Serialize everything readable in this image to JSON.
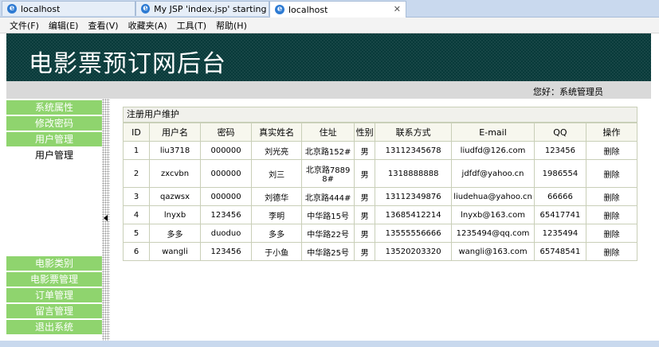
{
  "tabs": [
    {
      "label": "localhost"
    },
    {
      "label": "My JSP 'index.jsp' starting ..."
    },
    {
      "label": "localhost"
    }
  ],
  "menu": [
    "文件(F)",
    "编辑(E)",
    "查看(V)",
    "收藏夹(A)",
    "工具(T)",
    "帮助(H)"
  ],
  "site_title": "电影票预订网后台",
  "greeting": "您好：系统管理员",
  "sidebar": {
    "top": [
      "系统属性",
      "修改密码",
      "用户管理"
    ],
    "sub": "用户管理",
    "bottom": [
      "电影类别",
      "电影票管理",
      "订单管理",
      "留言管理",
      "退出系统"
    ]
  },
  "panel_title": "注册用户维护",
  "table": {
    "headers": [
      "ID",
      "用户名",
      "密码",
      "真实姓名",
      "住址",
      "性别",
      "联系方式",
      "E-mail",
      "QQ",
      "操作"
    ],
    "rows": [
      [
        "1",
        "liu3718",
        "000000",
        "刘光亮",
        "北京路152#",
        "男",
        "13112345678",
        "liudfd@126.com",
        "123456",
        "删除"
      ],
      [
        "2",
        "zxcvbn",
        "000000",
        "刘三",
        "北京路78898#",
        "男",
        "1318888888",
        "jdfdf@yahoo.cn",
        "1986554",
        "删除"
      ],
      [
        "3",
        "qazwsx",
        "000000",
        "刘德华",
        "北京路444#",
        "男",
        "13112349876",
        "liudehua@yahoo.cn",
        "66666",
        "删除"
      ],
      [
        "4",
        "lnyxb",
        "123456",
        "李明",
        "中华路15号",
        "男",
        "13685412214",
        "lnyxb@163.com",
        "65417741",
        "删除"
      ],
      [
        "5",
        "多多",
        "duoduo",
        "多多",
        "中华路22号",
        "男",
        "13555556666",
        "1235494@qq.com",
        "1235494",
        "删除"
      ],
      [
        "6",
        "wangli",
        "123456",
        "于小鱼",
        "中华路25号",
        "男",
        "13520203320",
        "wangli@163.com",
        "65748541",
        "删除"
      ]
    ]
  }
}
